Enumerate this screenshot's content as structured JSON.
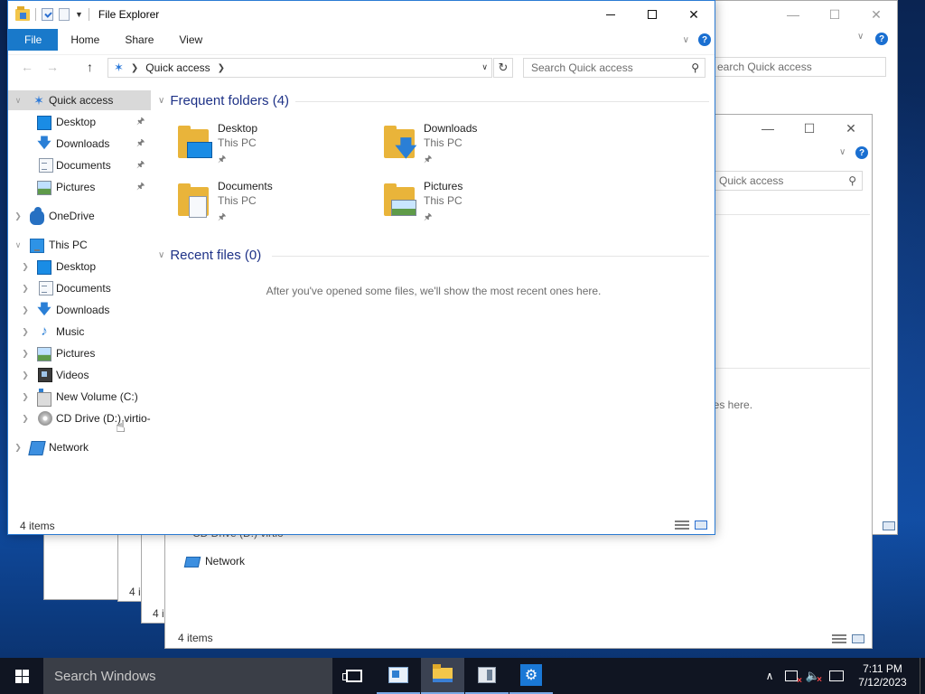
{
  "window": {
    "title": "File Explorer",
    "status_items": "4 items"
  },
  "ribbon": {
    "tabs": [
      "File",
      "Home",
      "Share",
      "View"
    ],
    "help": "?"
  },
  "address": {
    "location": "Quick access",
    "search_placeholder": "Search Quick access"
  },
  "nav": {
    "quick_access": "Quick access",
    "quick_items": [
      "Desktop",
      "Downloads",
      "Documents",
      "Pictures"
    ],
    "onedrive": "OneDrive",
    "this_pc": "This PC",
    "pc_items": [
      "Desktop",
      "Documents",
      "Downloads",
      "Music",
      "Pictures",
      "Videos",
      "New Volume (C:)",
      "CD Drive (D:) virtio-"
    ],
    "network": "Network"
  },
  "content": {
    "frequent_header": "Frequent folders (4)",
    "folders": [
      {
        "name": "Desktop",
        "location": "This PC"
      },
      {
        "name": "Downloads",
        "location": "This PC"
      },
      {
        "name": "Documents",
        "location": "This PC"
      },
      {
        "name": "Pictures",
        "location": "This PC"
      }
    ],
    "recent_header": "Recent files (0)",
    "recent_empty": "After you've opened some files, we'll show the most recent ones here."
  },
  "background_windows": {
    "search_right": "earch Quick access",
    "search_mid": "n Quick access",
    "recent_partial": "nes here.",
    "cd_partial": "CD Drive (D:) virtio",
    "network": "Network",
    "status": "4 items",
    "status_partial_1": "4 i",
    "status_partial_2": "4 i"
  },
  "taskbar": {
    "search_placeholder": "Search Windows",
    "time": "7:11 PM",
    "date": "7/12/2023"
  }
}
